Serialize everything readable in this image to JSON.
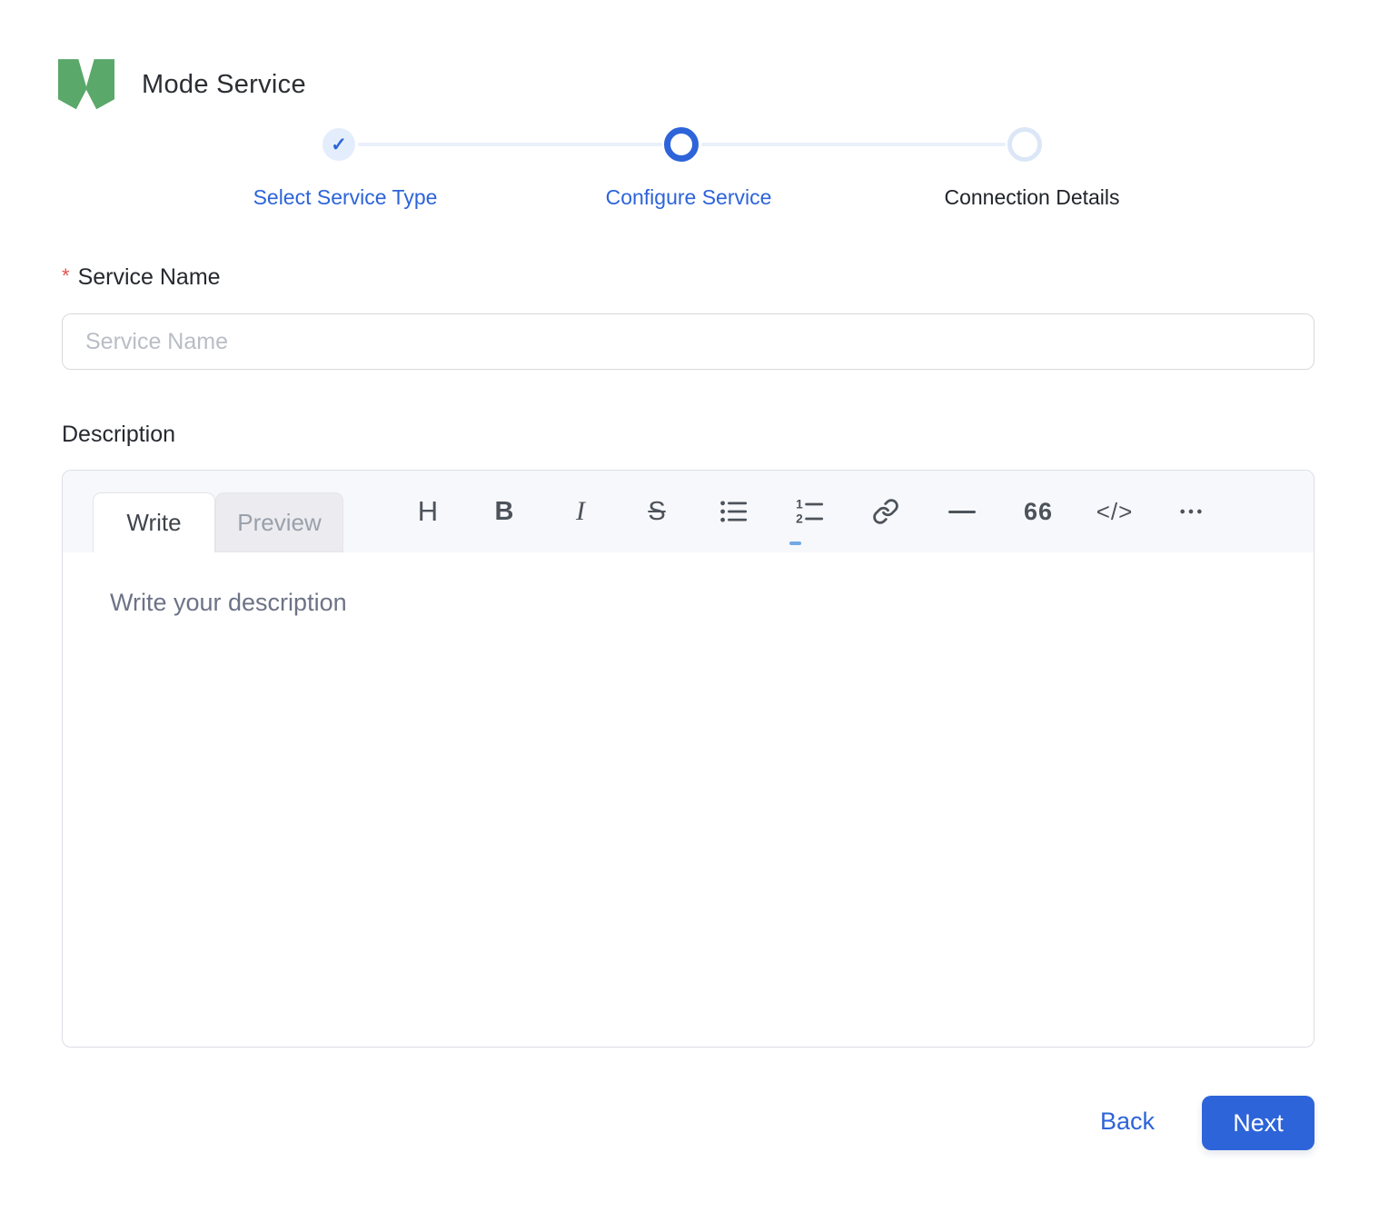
{
  "header": {
    "app_name": "Mode Service",
    "logo": {
      "icon": "m-logo-icon",
      "color": "#5aa86a"
    }
  },
  "stepper": {
    "accent_color": "#2d64d9",
    "steps": [
      {
        "label": "Select Service Type",
        "state": "completed",
        "icon": "check-icon",
        "check_glyph": "✓"
      },
      {
        "label": "Configure Service",
        "state": "active"
      },
      {
        "label": "Connection Details",
        "state": "upcoming"
      }
    ]
  },
  "form": {
    "service_name": {
      "label": "Service Name",
      "required_marker": "*",
      "required_color": "#e0534e",
      "value": "",
      "placeholder": "Service Name"
    },
    "description": {
      "label": "Description",
      "tabs": [
        {
          "label": "Write",
          "active": true
        },
        {
          "label": "Preview",
          "active": false
        }
      ],
      "toolbar": [
        {
          "name": "heading",
          "glyph": "H"
        },
        {
          "name": "bold",
          "glyph": "B"
        },
        {
          "name": "italic",
          "glyph": "I"
        },
        {
          "name": "strikethrough",
          "glyph": "S"
        },
        {
          "name": "unordered-list"
        },
        {
          "name": "ordered-list"
        },
        {
          "name": "link"
        },
        {
          "name": "horizontal-rule"
        },
        {
          "name": "quote",
          "glyph": "66"
        },
        {
          "name": "code",
          "glyph": "</>"
        },
        {
          "name": "more"
        }
      ],
      "value": "",
      "placeholder": "Write your description"
    }
  },
  "footer": {
    "back_label": "Back",
    "next_label": "Next",
    "next_color": "#2d64d9"
  }
}
